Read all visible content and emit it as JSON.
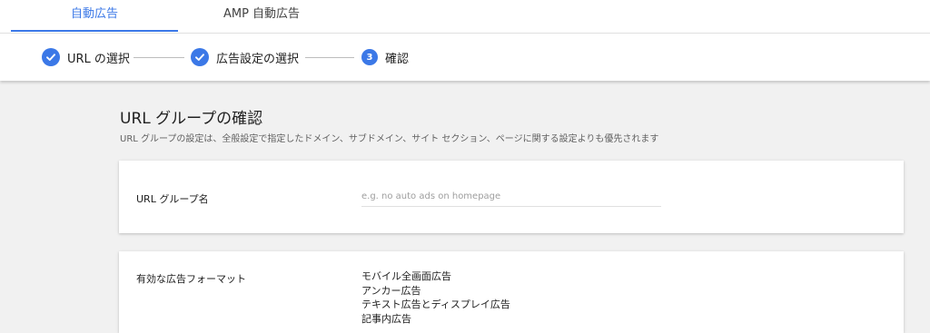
{
  "tabs": [
    {
      "label": "自動広告",
      "active": true
    },
    {
      "label": "AMP 自動広告",
      "active": false
    }
  ],
  "stepper": {
    "steps": [
      {
        "label": "URL の選択",
        "status": "done",
        "icon": "check-icon"
      },
      {
        "label": "広告設定の選択",
        "status": "done",
        "icon": "check-icon"
      },
      {
        "label": "確認",
        "status": "current",
        "number": "3"
      }
    ]
  },
  "page": {
    "title": "URL グループの確認",
    "subtitle": "URL グループの設定は、全般設定で指定したドメイン、サブドメイン、サイト セクション、ページに関する設定よりも優先されます"
  },
  "url_group": {
    "label": "URL グループ名",
    "value": "",
    "placeholder": "e.g. no auto ads on homepage"
  },
  "ad_formats": {
    "label": "有効な広告フォーマット",
    "items": [
      "モバイル全画面広告",
      "アンカー広告",
      "テキスト広告とディスプレイ広告",
      "記事内広告"
    ]
  },
  "colors": {
    "accent": "#3b78e7",
    "background": "#f1f1f1",
    "card": "#ffffff"
  }
}
